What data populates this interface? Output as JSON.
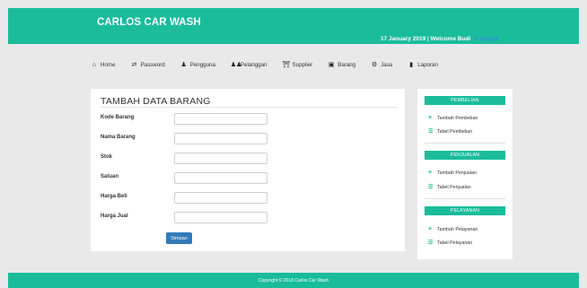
{
  "header": {
    "brand": "CARLOS CAR WASH",
    "welcome": "17 January 2019 | Welcome Budi",
    "logout_label": "Logout"
  },
  "nav": [
    {
      "label": "Home",
      "icon": "home-icon"
    },
    {
      "label": "Password",
      "icon": "exchange-icon"
    },
    {
      "label": "Pengguna",
      "icon": "user-icon"
    },
    {
      "label": "Pelanggan",
      "icon": "users-icon"
    },
    {
      "label": "Supplier",
      "icon": "bank-icon"
    },
    {
      "label": "Barang",
      "icon": "package-icon"
    },
    {
      "label": "Jasa",
      "icon": "gear-icon"
    },
    {
      "label": "Laporan",
      "icon": "file-icon"
    }
  ],
  "form": {
    "title": "TAMBAH DATA BARANG",
    "fields": [
      {
        "label": "Kode Barang",
        "value": ""
      },
      {
        "label": "Nama Barang",
        "value": ""
      },
      {
        "label": "Stok",
        "value": ""
      },
      {
        "label": "Satuan",
        "value": ""
      },
      {
        "label": "Harga Beli",
        "value": ""
      },
      {
        "label": "Harga Jual",
        "value": ""
      }
    ],
    "submit_label": "Simpan"
  },
  "sidebar": {
    "sections": [
      {
        "title": "PEMBELIAN",
        "links": [
          "Tambah Pembelian",
          "Tabel Pembelian"
        ]
      },
      {
        "title": "PENJUALAN",
        "links": [
          "Tambah Penjualan",
          "Tabel Penjualan"
        ]
      },
      {
        "title": "PELAYANAN",
        "links": [
          "Tambah Pelayanan",
          "Tabel Pelayanan"
        ]
      }
    ]
  },
  "footer": {
    "text": "Copyright © 2018 Carlos Car Wash"
  },
  "colors": {
    "accent": "#1abc9c",
    "button": "#337ab7",
    "link": "#2e86de"
  }
}
